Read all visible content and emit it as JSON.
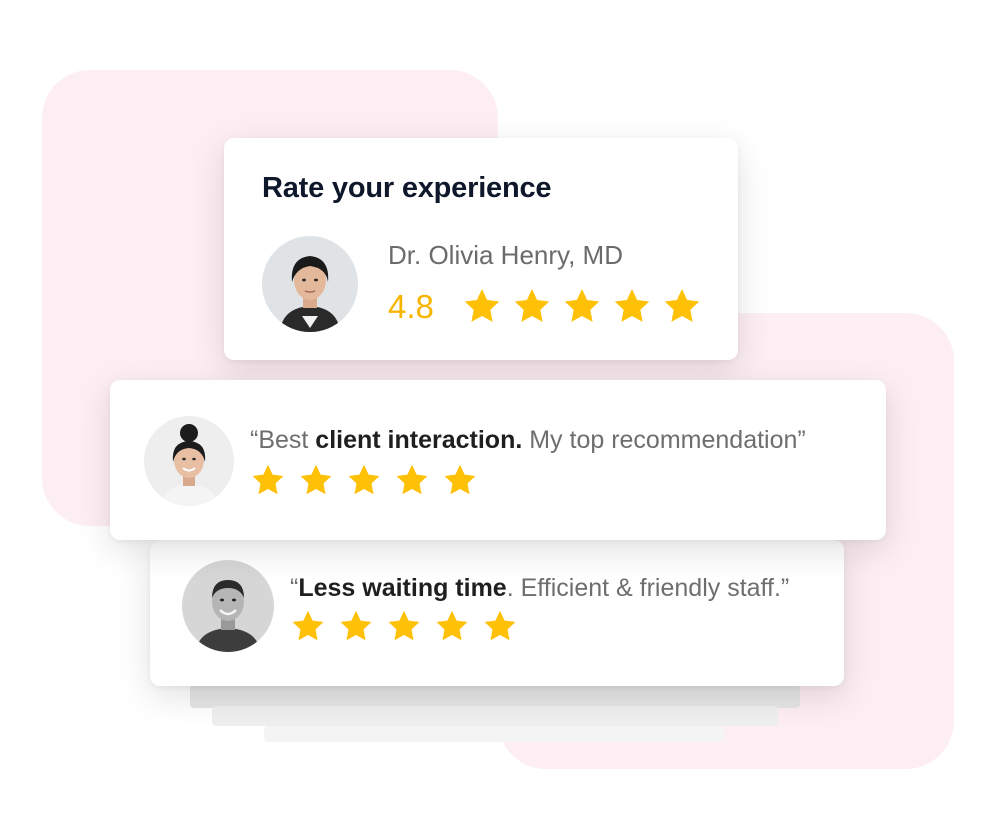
{
  "colors": {
    "accent_star": "#FFC107",
    "rating_text": "#F7B500",
    "background_blob": "#FDEEF3",
    "title_text": "#0F172A"
  },
  "rate_card": {
    "title": "Rate your experience",
    "doctor": {
      "avatar_icon": "doctor-avatar",
      "name": "Dr. Olivia Henry, MD",
      "rating": "4.8",
      "stars": 5
    }
  },
  "reviews": [
    {
      "avatar_icon": "reviewer-woman-avatar",
      "quote_open": "“Best ",
      "quote_bold": "client interaction.",
      "quote_rest": " My top recommendation”",
      "stars": 5
    },
    {
      "avatar_icon": "reviewer-man-avatar",
      "quote_open": "“",
      "quote_bold": "Less waiting time",
      "quote_rest": ". Efficient & friendly staff.”",
      "stars": 5
    }
  ]
}
